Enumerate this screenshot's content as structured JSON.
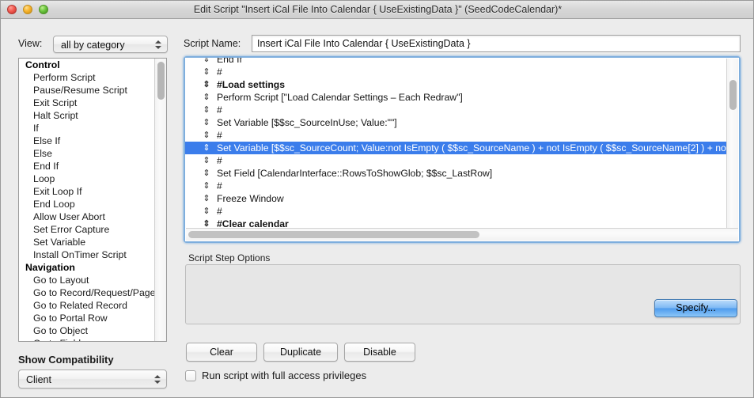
{
  "window": {
    "title": "Edit Script \"Insert iCal File Into Calendar { UseExistingData }\" (SeedCodeCalendar)*",
    "traffic_lights": [
      "close-button",
      "minimize-button",
      "zoom-button"
    ]
  },
  "left_panel": {
    "view_label": "View:",
    "view_value": "all by category",
    "compatibility_label": "Show Compatibility",
    "compatibility_value": "Client",
    "groups": [
      {
        "category": "Control",
        "steps": [
          "Perform Script",
          "Pause/Resume Script",
          "Exit Script",
          "Halt Script",
          "If",
          "Else If",
          "Else",
          "End If",
          "Loop",
          "Exit Loop If",
          "End Loop",
          "Allow User Abort",
          "Set Error Capture",
          "Set Variable",
          "Install OnTimer Script"
        ]
      },
      {
        "category": "Navigation",
        "steps": [
          "Go to Layout",
          "Go to Record/Request/Page",
          "Go to Related Record",
          "Go to Portal Row",
          "Go to Object",
          "Go to Field"
        ]
      }
    ]
  },
  "script_name": {
    "label": "Script Name:",
    "value": "Insert iCal File Into Calendar { UseExistingData }"
  },
  "script_body": {
    "rows": [
      {
        "text": "End If",
        "comment": false,
        "selected": false,
        "clipped_top": true
      },
      {
        "text": "#",
        "comment": false,
        "selected": false
      },
      {
        "text": "#Load settings",
        "comment": true,
        "selected": false
      },
      {
        "text": "Perform Script [\"Load Calendar Settings – Each Redraw\"]",
        "comment": false,
        "selected": false
      },
      {
        "text": "#",
        "comment": false,
        "selected": false
      },
      {
        "text": "Set Variable [$$sc_SourceInUse; Value:\"\"]",
        "comment": false,
        "selected": false
      },
      {
        "text": "#",
        "comment": false,
        "selected": false
      },
      {
        "text": "Set Variable [$$sc_SourceCount; Value:not IsEmpty ( $$sc_SourceName ) + not IsEmpty ( $$sc_SourceName[2]  ) + not IsE",
        "comment": false,
        "selected": true
      },
      {
        "text": "#",
        "comment": false,
        "selected": false
      },
      {
        "text": "Set Field [CalendarInterface::RowsToShowGlob; $$sc_LastRow]",
        "comment": false,
        "selected": false
      },
      {
        "text": "#",
        "comment": false,
        "selected": false
      },
      {
        "text": "Freeze Window",
        "comment": false,
        "selected": false
      },
      {
        "text": "#",
        "comment": false,
        "selected": false
      },
      {
        "text": "#Clear calendar",
        "comment": true,
        "selected": false
      }
    ],
    "drag_handle_glyph": "⇕"
  },
  "options": {
    "label": "Script Step Options",
    "specify_label": "Specify..."
  },
  "actions": {
    "clear_label": "Clear",
    "duplicate_label": "Duplicate",
    "disable_label": "Disable",
    "full_access_label": "Run script with full access privileges",
    "full_access_checked": false
  },
  "colors": {
    "selection_blue": "#3b7deb",
    "focus_ring": "#7eaedd",
    "default_button_blue": "#4e9bed",
    "window_bg": "#ececec"
  }
}
